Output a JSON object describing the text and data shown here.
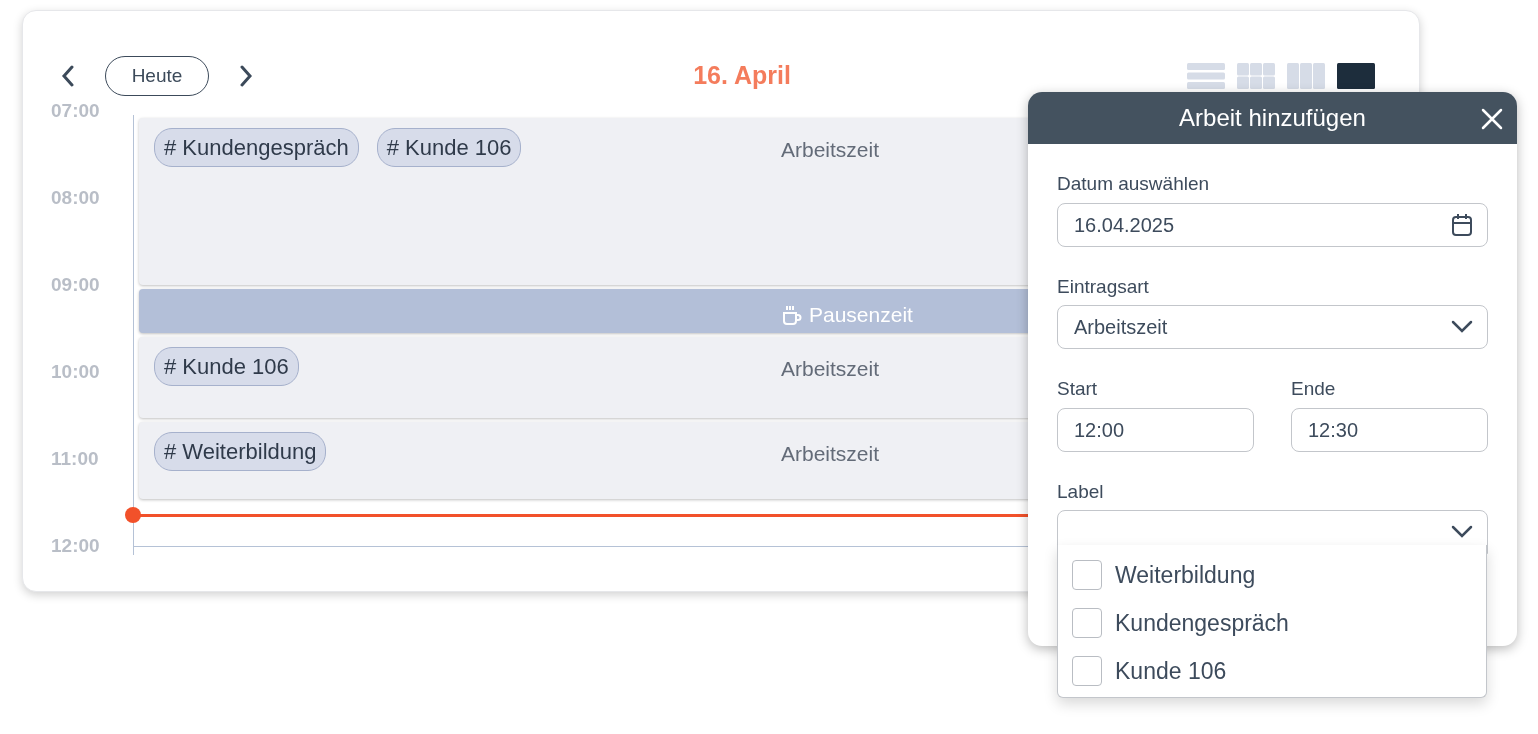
{
  "navigation": {
    "today_button": "Heute"
  },
  "title": "16. April",
  "view_options": [
    {
      "kind": "list",
      "selected": false
    },
    {
      "kind": "grid",
      "selected": false
    },
    {
      "kind": "columns",
      "selected": false
    },
    {
      "kind": "day",
      "selected": true
    }
  ],
  "time_labels": [
    "07:00",
    "08:00",
    "09:00",
    "10:00",
    "11:00",
    "12:00"
  ],
  "entries": [
    {
      "kind": "work",
      "tags": [
        "# Kundengespräch",
        "# Kunde 106"
      ],
      "type": "Arbeitszeit"
    },
    {
      "kind": "break",
      "type": "Pausenzeit"
    },
    {
      "kind": "work",
      "tags": [
        "# Kunde 106"
      ],
      "type": "Arbeitszeit"
    },
    {
      "kind": "work",
      "tags": [
        "# Weiterbildung"
      ],
      "type": "Arbeitszeit"
    }
  ],
  "dialog": {
    "title": "Arbeit hinzufügen",
    "fields": [
      {
        "kind": "date",
        "label": "Datum auswählen",
        "value": "16.04.2025"
      },
      {
        "kind": "select",
        "label": "Eintragsart",
        "value": "Arbeitszeit"
      }
    ],
    "time_fields": [
      {
        "label": "Start",
        "value": "12:00"
      },
      {
        "label": "Ende",
        "value": "12:30"
      }
    ],
    "label_field": {
      "label": "Label",
      "expanded": true,
      "options": [
        {
          "text": "Weiterbildung",
          "checked": false
        },
        {
          "text": "Kundengespräch",
          "checked": false
        },
        {
          "text": "Kunde 106",
          "checked": false
        }
      ]
    }
  }
}
